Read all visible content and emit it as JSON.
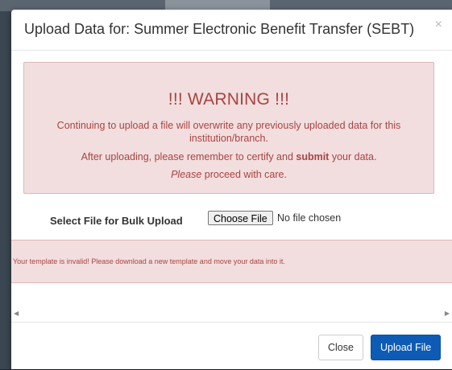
{
  "modal": {
    "title": "Upload Data for: Summer Electronic Benefit Transfer (SEBT)",
    "close_icon": "×"
  },
  "warning": {
    "title": "!!! WARNING !!!",
    "line1": "Continuing to upload a file will overwrite any previously uploaded data for this institution/branch.",
    "line2_before": "After uploading, please remember to certify and ",
    "line2_strong": "submit",
    "line2_after": " your data.",
    "line3_em": "Please",
    "line3_rest": " proceed with care."
  },
  "upload": {
    "label": "Select File for Bulk Upload",
    "choose_button": "Choose File",
    "no_file_text": "No file chosen"
  },
  "error": {
    "message": "Your template is invalid! Please download a new template and move your data into it."
  },
  "scroll": {
    "left_icon": "◀",
    "right_icon": "▶"
  },
  "footer": {
    "close_label": "Close",
    "upload_label": "Upload File"
  },
  "colors": {
    "warning_bg": "#f2dede",
    "warning_text": "#a94442",
    "primary": "#0d5bb5"
  }
}
